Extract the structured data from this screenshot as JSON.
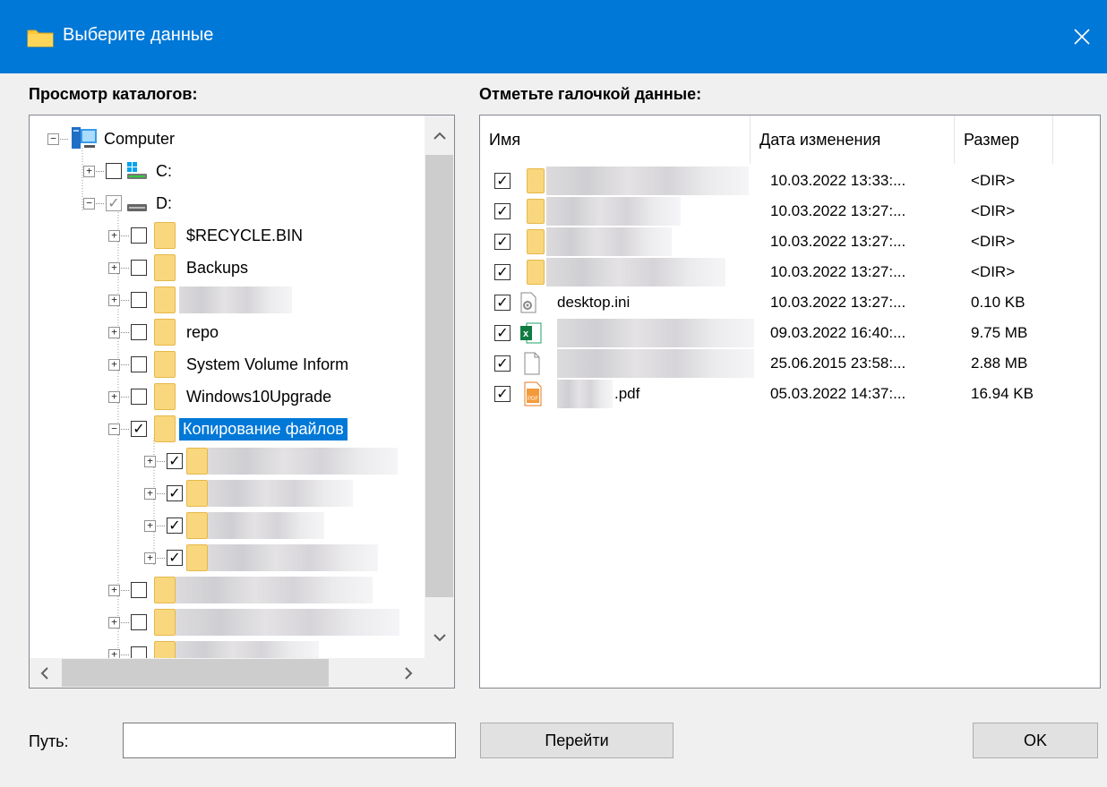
{
  "window": {
    "title": "Выберите данные",
    "accent": "#0078d7"
  },
  "tree_panel": {
    "label": "Просмотр каталогов:",
    "nodes": [
      {
        "name": "Computer",
        "icon": "computer-icon",
        "state": "expanded",
        "checkbox": "none"
      },
      {
        "name": "C:",
        "icon": "windows-drive-icon",
        "state": "collapsed",
        "checkbox": "unchecked"
      },
      {
        "name": "D:",
        "icon": "drive-icon",
        "state": "expanded",
        "checkbox": "checked-grey"
      },
      {
        "name": "$RECYCLE.BIN",
        "icon": "folder-icon",
        "state": "collapsed",
        "checkbox": "unchecked"
      },
      {
        "name": "Backups",
        "icon": "folder-icon",
        "state": "collapsed",
        "checkbox": "unchecked"
      },
      {
        "name": "",
        "icon": "folder-icon",
        "state": "collapsed",
        "checkbox": "unchecked"
      },
      {
        "name": "repo",
        "icon": "folder-icon",
        "state": "collapsed",
        "checkbox": "unchecked"
      },
      {
        "name": "System Volume Inform",
        "icon": "folder-icon",
        "state": "collapsed",
        "checkbox": "unchecked"
      },
      {
        "name": "Windows10Upgrade",
        "icon": "folder-icon",
        "state": "collapsed",
        "checkbox": "unchecked"
      },
      {
        "name": "Копирование файлов",
        "icon": "folder-icon",
        "state": "expanded",
        "checkbox": "checked",
        "selected": true
      },
      {
        "name": "",
        "icon": "folder-icon",
        "state": "collapsed",
        "checkbox": "checked"
      },
      {
        "name": "",
        "icon": "folder-icon",
        "state": "collapsed",
        "checkbox": "checked"
      },
      {
        "name": "",
        "icon": "folder-icon",
        "state": "collapsed",
        "checkbox": "checked"
      },
      {
        "name": "",
        "icon": "folder-icon",
        "state": "collapsed",
        "checkbox": "checked"
      },
      {
        "name": "",
        "icon": "folder-icon",
        "state": "collapsed",
        "checkbox": "unchecked"
      },
      {
        "name": "",
        "icon": "folder-icon",
        "state": "collapsed",
        "checkbox": "unchecked"
      },
      {
        "name": "",
        "icon": "folder-icon",
        "state": "collapsed",
        "checkbox": "unchecked"
      }
    ]
  },
  "list_panel": {
    "label": "Отметьте галочкой данные:",
    "columns": [
      "Имя",
      "Дата изменения",
      "Размер"
    ],
    "rows": [
      {
        "name": "",
        "icon": "folder-icon",
        "date": "10.03.2022 13:33:...",
        "size": "<DIR>",
        "checked": true
      },
      {
        "name": "",
        "icon": "folder-icon",
        "date": "10.03.2022 13:27:...",
        "size": "<DIR>",
        "checked": true
      },
      {
        "name": "",
        "icon": "folder-icon",
        "date": "10.03.2022 13:27:...",
        "size": "<DIR>",
        "checked": true
      },
      {
        "name": "",
        "icon": "folder-icon",
        "date": "10.03.2022 13:27:...",
        "size": "<DIR>",
        "checked": true
      },
      {
        "name": "desktop.ini",
        "icon": "settings-file-icon",
        "date": "10.03.2022 13:27:...",
        "size": "0.10 KB",
        "checked": true
      },
      {
        "name": "",
        "icon": "excel-file-icon",
        "date": "09.03.2022 16:40:...",
        "size": "9.75 MB",
        "checked": true
      },
      {
        "name": "",
        "icon": "blank-file-icon",
        "date": "25.06.2015 23:58:...",
        "size": "2.88 MB",
        "checked": true
      },
      {
        "name": ".pdf",
        "icon": "pdf-file-icon",
        "date": "05.03.2022 14:37:...",
        "size": "16.94 KB",
        "checked": true
      }
    ]
  },
  "footer": {
    "path_label": "Путь:",
    "path_value": "",
    "go_button": "Перейти",
    "ok_button": "OK"
  }
}
